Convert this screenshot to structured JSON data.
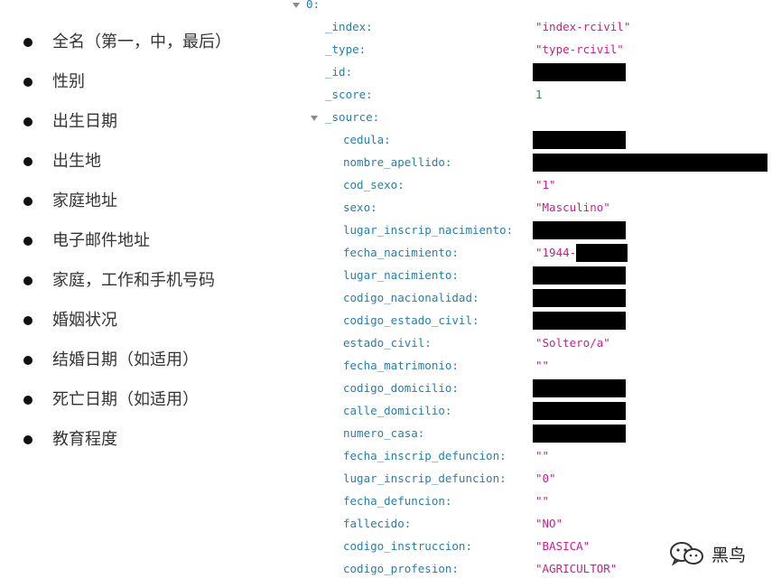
{
  "fields_list": [
    "全名（第一，中，最后）",
    "性别",
    "出生日期",
    "出生地",
    "家庭地址",
    "电子邮件地址",
    "家庭，工作和手机号码",
    "婚姻状况",
    "结婚日期（如适用）",
    "死亡日期（如适用）",
    "教育程度"
  ],
  "json": {
    "root_key": "0:",
    "index_key": "_index:",
    "index_val": "\"index-rcivil\"",
    "type_key": "_type:",
    "type_val": "\"type-rcivil\"",
    "id_key": "_id:",
    "score_key": "_score:",
    "score_val": "1",
    "source_key": "_source:",
    "source": {
      "cedula": "cedula:",
      "nombre_apellido": "nombre_apellido:",
      "cod_sexo": "cod_sexo:",
      "cod_sexo_val": "\"1\"",
      "sexo": "sexo:",
      "sexo_val": "\"Masculino\"",
      "lugar_inscrip_nacimiento": "lugar_inscrip_nacimiento:",
      "fecha_nacimiento": "fecha_nacimiento:",
      "fecha_nacimiento_val": "\"1944-",
      "lugar_nacimiento": "lugar_nacimiento:",
      "codigo_nacionalidad": "codigo_nacionalidad:",
      "codigo_estado_civil": "codigo_estado_civil:",
      "estado_civil": "estado_civil:",
      "estado_civil_val": "\"Soltero/a\"",
      "fecha_matrimonio": "fecha_matrimonio:",
      "fecha_matrimonio_val": "\"\"",
      "codigo_domicilio": "codigo_domicilio:",
      "calle_domicilio": "calle_domicilio:",
      "numero_casa": "numero_casa:",
      "fecha_inscrip_defuncion": "fecha_inscrip_defuncion:",
      "fecha_inscrip_defuncion_val": "\"\"",
      "lugar_inscrip_defuncion": "lugar_inscrip_defuncion:",
      "lugar_inscrip_defuncion_val": "\"0\"",
      "fecha_defuncion": "fecha_defuncion:",
      "fecha_defuncion_val": "\"\"",
      "fallecido": "fallecido:",
      "fallecido_val": "\"NO\"",
      "codigo_instruccion": "codigo_instruccion:",
      "codigo_instruccion_val": "\"BASICA\"",
      "codigo_profesion": "codigo_profesion:",
      "codigo_profesion_val": "\"AGRICULTOR\""
    }
  },
  "watermark": {
    "icon": "wechat-icon",
    "text": "黑鸟"
  }
}
